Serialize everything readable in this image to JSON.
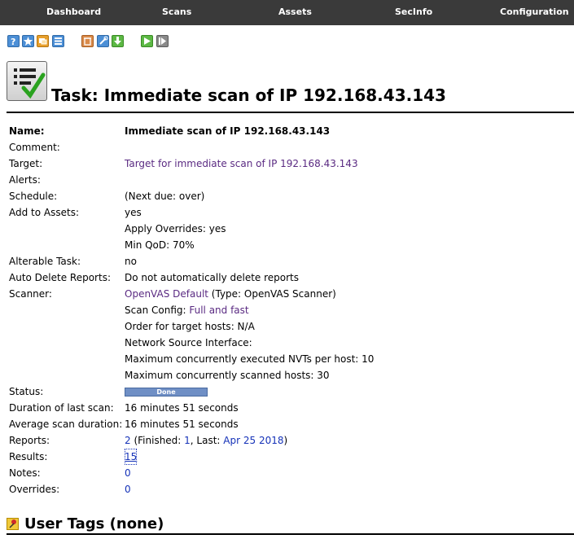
{
  "nav": {
    "items": [
      "Dashboard",
      "Scans",
      "Assets",
      "SecInfo",
      "Configuration"
    ]
  },
  "toolbar": {
    "icons": [
      "help-icon",
      "new-task-icon",
      "clone-icon",
      "list-icon",
      "trash-icon",
      "edit-icon",
      "export-icon",
      "start-icon",
      "resume-icon"
    ]
  },
  "page": {
    "title": "Task: Immediate scan of IP 192.168.43.143"
  },
  "details": {
    "name_label": "Name:",
    "name_value": "Immediate scan of IP 192.168.43.143",
    "comment_label": "Comment:",
    "target_label": "Target:",
    "target_value": "Target for immediate scan of IP 192.168.43.143",
    "alerts_label": "Alerts:",
    "schedule_label": "Schedule:",
    "schedule_value": "(Next due: over)",
    "assets_label": "Add to Assets:",
    "assets_value": "yes",
    "overrides_apply": "Apply Overrides: yes",
    "min_qod": "Min QoD: 70%",
    "alterable_label": "Alterable Task:",
    "alterable_value": "no",
    "autodelete_label": "Auto Delete Reports:",
    "autodelete_value": "Do not automatically delete reports",
    "scanner_label": "Scanner:",
    "scanner_link": "OpenVAS Default",
    "scanner_type": " (Type: OpenVAS Scanner)",
    "scan_config_label": "Scan Config: ",
    "scan_config_link": "Full and fast",
    "order_hosts": "Order for target hosts: N/A",
    "net_iface": "Network Source Interface:",
    "max_nvts": "Maximum concurrently executed NVTs per host: 10",
    "max_hosts": "Maximum concurrently scanned hosts: 30",
    "status_label": "Status:",
    "status_value": "Done",
    "duration_label": "Duration of last scan:",
    "duration_value": "16 minutes 51 seconds",
    "avg_label": "Average scan duration:",
    "avg_value": "16 minutes 51 seconds",
    "reports_label": "Reports:",
    "reports_count": "2",
    "reports_finished_prefix": " (Finished: ",
    "reports_finished": "1",
    "reports_last_prefix": ", Last: ",
    "reports_last": "Apr 25 2018",
    "reports_suffix": ")",
    "results_label": "Results:",
    "results_value": "15",
    "notes_label": "Notes:",
    "notes_value": "0",
    "overrides_label": "Overrides:",
    "overrides_value": "0"
  },
  "tags": {
    "title": "User Tags (none)"
  }
}
